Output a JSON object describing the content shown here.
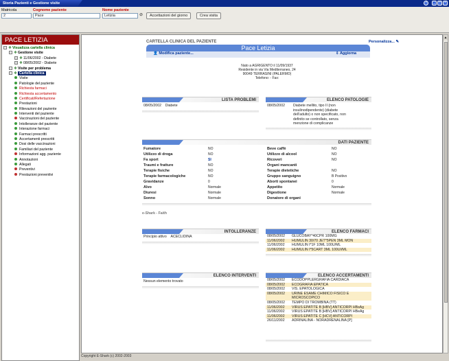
{
  "window": {
    "title": "Storia Pazienti e Gestione visite"
  },
  "toolbar": {
    "matricola_label": "Matricola",
    "matricola_value": "2",
    "cognome_label": "Cognome paziente",
    "cognome_value": "Pace",
    "nome_label": "Nome paziente",
    "nome_value": "Letizia",
    "accettazioni_label": "Accettazioni del giorno",
    "crea_visita_label": "Crea visita"
  },
  "sidebar": {
    "patient_name": "PACE LETIZIA",
    "items": [
      {
        "label": "Visualizza cartella clinica",
        "level": 0,
        "bold": true,
        "color": "#006600"
      },
      {
        "label": "Gestione visite",
        "level": 1,
        "bold": true,
        "color": "#000000"
      },
      {
        "label": "11/06/2002 - Diabete",
        "level": 2,
        "bold": false,
        "color": "#000000"
      },
      {
        "label": "08/05/2002 - Diabete",
        "level": 2,
        "bold": false,
        "color": "#000000"
      },
      {
        "label": "Visite per problema",
        "level": 1,
        "bold": true,
        "color": "#000000"
      },
      {
        "label": "Cartella clinica",
        "level": 1,
        "bold": true,
        "color": "#ffffff",
        "selected": true
      },
      {
        "label": "Visite",
        "level": 2,
        "color": "#000000",
        "dot": "#3a9a3a"
      },
      {
        "label": "Patologie del paziente",
        "level": 2,
        "color": "#000000",
        "dot": "#3a9a3a"
      },
      {
        "label": "Richiesta farmaci",
        "level": 2,
        "color": "#c00000",
        "dot": "#3a9a3a"
      },
      {
        "label": "Richiesta accertamento",
        "level": 2,
        "color": "#c00000",
        "dot": "#3a9a3a"
      },
      {
        "label": "Certificati/Refertazione",
        "level": 2,
        "color": "#c00000",
        "dot": "#3a9a3a"
      },
      {
        "label": "Prestazioni",
        "level": 2,
        "color": "#000000",
        "dot": "#3a9a3a"
      },
      {
        "label": "Rilevazioni del paziente",
        "level": 2,
        "color": "#000000",
        "dot": "#3a9a3a"
      },
      {
        "label": "Interventi del paziente",
        "level": 2,
        "color": "#000000",
        "dot": "#3a9a3a"
      },
      {
        "label": "Vaccinazioni del paziente",
        "level": 2,
        "color": "#000000",
        "dot": "#c03030"
      },
      {
        "label": "Intolleranze del paziente",
        "level": 2,
        "color": "#000000",
        "dot": "#3a9a3a"
      },
      {
        "label": "Interazione farmaci",
        "level": 2,
        "color": "#000000",
        "dot": "#3a9a3a"
      },
      {
        "label": "Farmaci prescritti",
        "level": 2,
        "color": "#000000",
        "dot": "#3a9a3a"
      },
      {
        "label": "Accertamenti prescritti",
        "level": 2,
        "color": "#000000",
        "dot": "#3a9a3a"
      },
      {
        "label": "Dosi delle vaccinazioni",
        "level": 2,
        "color": "#000000",
        "dot": "#3a9a3a"
      },
      {
        "label": "Familiari del paziente",
        "level": 2,
        "color": "#000000",
        "dot": "#3a9a3a"
      },
      {
        "label": "Informazioni agg. paziente",
        "level": 2,
        "color": "#000000",
        "dot": "#c03030"
      },
      {
        "label": "Annotazioni",
        "level": 2,
        "color": "#000000",
        "dot": "#3a9a3a"
      },
      {
        "label": "Allegati",
        "level": 2,
        "color": "#000000",
        "dot": "#3a9a3a"
      },
      {
        "label": "Preventivi",
        "level": 2,
        "color": "#000000",
        "dot": "#c03030"
      },
      {
        "label": "Prestazioni preventivi",
        "level": 2,
        "color": "#000000",
        "dot": "#c03030"
      }
    ]
  },
  "main": {
    "title": "CARTELLA CLINICA DEL PAZIENTE",
    "personalizza": "Personalizza...",
    "patient": "Pace Letizia",
    "modifica": "Modifica paziente...",
    "aggiorna": "Aggiorna",
    "address": [
      "Nato a AGRIGENTO il 11/09/1937",
      "Residente in via Via Mediterraneo, 24",
      "90049 TERRASINI (PALERMO)",
      "Telefono: - Fax:"
    ],
    "lista_problemi": {
      "title": "LISTA PROBLEMI",
      "rows": [
        {
          "date": "08/05/2002",
          "text": "Diabete"
        }
      ]
    },
    "elenco_patologie": {
      "title": "ELENCO PATOLOGIE",
      "date": "08/05/2002",
      "text": [
        "Diabete mellito, tipo II (non",
        "insulinodipendente) (diabete",
        "dell'adulto) o non specificato, non",
        "definito se controllato, senza",
        "menzione di complicanze"
      ]
    },
    "dati_paziente": {
      "title": "DATI PAZIENTE",
      "left": [
        {
          "k": "Fumatore",
          "v": "NO"
        },
        {
          "k": "Utilizzo di droga",
          "v": "NO"
        },
        {
          "k": "Fa sport",
          "v": "SI"
        },
        {
          "k": "Traumi e fratture",
          "v": "NO"
        },
        {
          "k": "Terapie fisiche",
          "v": "NO"
        },
        {
          "k": "Terapie farmacologiche",
          "v": "NO"
        },
        {
          "k": "Gravidanze",
          "v": "0"
        },
        {
          "k": "Alvo",
          "v": "Normale"
        },
        {
          "k": "Diuresi",
          "v": "Normale"
        },
        {
          "k": "Sonno",
          "v": "Normale"
        }
      ],
      "right": [
        {
          "k": "Beve caffè",
          "v": "NO"
        },
        {
          "k": "Utilizzo di alcool",
          "v": "NO"
        },
        {
          "k": "Ricoveri",
          "v": "NO"
        },
        {
          "k": "Organi mancanti",
          "v": ""
        },
        {
          "k": "Terapie dietetiche",
          "v": "NO"
        },
        {
          "k": "Gruppo sanguigno",
          "v": "B Positivo"
        },
        {
          "k": "Aborti spontanei",
          "v": "0"
        },
        {
          "k": "Appetito",
          "v": "Normale"
        },
        {
          "k": "Digestione",
          "v": "Normale"
        },
        {
          "k": "Donatore di organi",
          "v": ""
        }
      ]
    },
    "eshark": "e-Shark - Faith",
    "intolleranze": {
      "title": "INTOLLERANZE",
      "label": "Principio attivo",
      "value": "ACECLIDINA"
    },
    "elenco_farmaci": {
      "title": "ELENCO FARMACI",
      "rows": [
        {
          "date": "08/05/2002",
          "text": "GLUCOBAY*40CPR 100MG",
          "hl": false
        },
        {
          "date": "11/06/2002",
          "text": "HUMULIN 30/70 JET*5PEN 3ML MON",
          "hl": true
        },
        {
          "date": "11/06/2002",
          "text": "HUMULIN I*1F 10ML 100U/ML",
          "hl": false
        },
        {
          "date": "11/06/2002",
          "text": "HUMULIN I*5CART 3ML 100UI/ML",
          "hl": true
        }
      ]
    },
    "elenco_interventi": {
      "title": "ELENCO INTERVENTI",
      "empty": "Nessun elemento trovato"
    },
    "elenco_accertamenti": {
      "title": "ELENCO ACCERTAMENTI",
      "rows": [
        {
          "date": "08/05/2002",
          "text": "ECODOPPLERGRAFIA CARDIACA",
          "hl": false
        },
        {
          "date": "08/05/2002",
          "text": "ECOGRAFIA EPATICA",
          "hl": true
        },
        {
          "date": "08/05/2002",
          "text": "VIS. EPATOLOGICA",
          "hl": false
        },
        {
          "date": "08/05/2002",
          "text": "URINE ESAME CHIMICO FISICO E MICROSCOPICO",
          "hl": true
        },
        {
          "date": "08/05/2002",
          "text": "TEMPO DI TROMBINA (TT)",
          "hl": false
        },
        {
          "date": "11/06/2002",
          "text": "VIRUS EPATITE B [HBV] ANTICORPI HBsAg",
          "hl": true
        },
        {
          "date": "11/06/2002",
          "text": "VIRUS EPATITE B [HBV] ANTICORPI HBeAg",
          "hl": false
        },
        {
          "date": "11/06/2002",
          "text": "VIRUS EPATITE C [HCV] ANTICORPI",
          "hl": true
        },
        {
          "date": "26/11/2002",
          "text": "ADRINALINA - NORADRENALINA [P]",
          "hl": false
        }
      ]
    }
  },
  "footer": "Copyright E-Shark (c) 2002-2003"
}
